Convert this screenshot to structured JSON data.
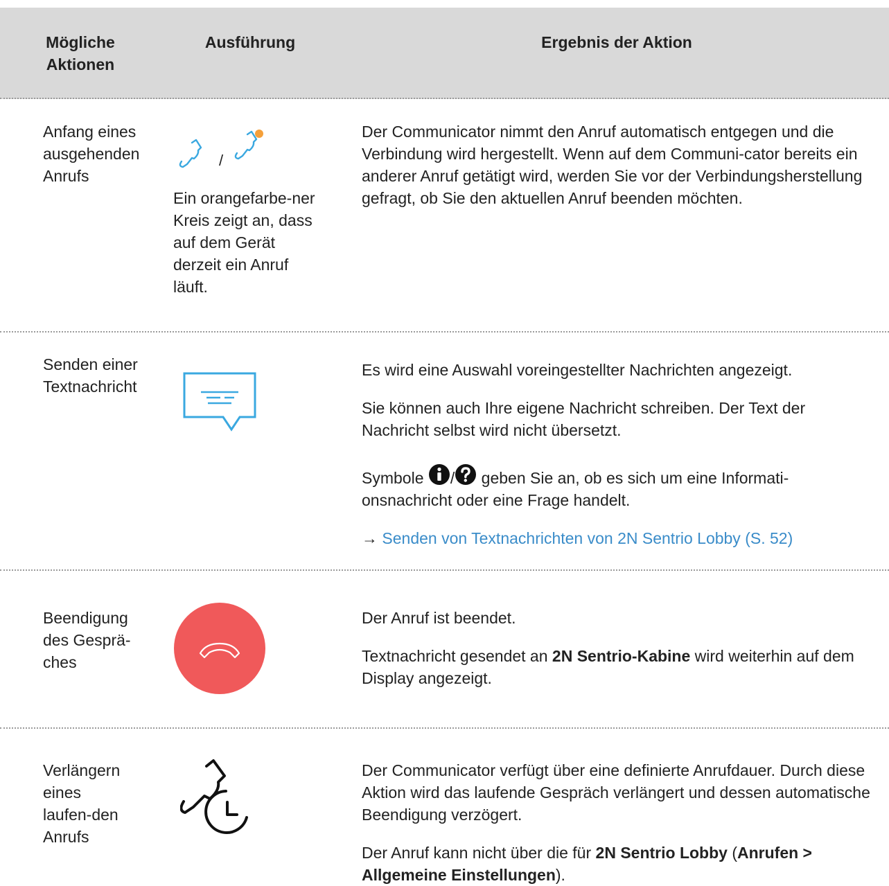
{
  "header": {
    "col1": "Mögliche Aktionen",
    "col2": "Ausführung",
    "col3": "Ergebnis der Aktion"
  },
  "rows": [
    {
      "action": "Anfang eines ausgehenden Anrufs",
      "icons": [
        "phone-handset-icon",
        "phone-handset-active-icon"
      ],
      "icon_separator": "/",
      "execution_note": "Ein orangefarbe-ner Kreis zeigt an, dass auf dem Gerät derzeit ein Anruf läuft.",
      "result": "Der Communicator nimmt den Anruf automatisch entgegen und die Verbindung wird hergestellt. Wenn auf dem Communi-cator bereits ein anderer Anruf getätigt wird, werden Sie vor der Verbindungsherstellung gefragt, ob Sie den aktuellen Anruf beenden möchten."
    },
    {
      "action": "Senden einer Textnachricht",
      "icons": [
        "text-message-icon"
      ],
      "result_p1": "Es wird eine Auswahl voreingestellter Nachrichten angezeigt.",
      "result_p2": "Sie können auch Ihre eigene Nachricht schreiben. Der Text der Nachricht selbst wird nicht übersetzt.",
      "result_p3_prefix": "Symbole ",
      "result_p3_sep": "/",
      "result_p3_suffix": " geben Sie an, ob es sich um eine Informati-onsnachricht oder eine Frage handelt.",
      "info_icon": "info-icon",
      "question_icon": "question-icon",
      "link_arrow": "→ ",
      "link_text": "Senden von Textnachrichten von 2N Sentrio Lobby (S. 52)"
    },
    {
      "action": "Beendigung des Gesprä-ches",
      "icons": [
        "hang-up-icon"
      ],
      "result_p1": "Der Anruf ist beendet.",
      "result_p2_prefix": "Textnachricht gesendet an ",
      "result_p2_bold": "2N Sentrio-Kabine",
      "result_p2_suffix": " wird weiterhin auf dem Display angezeigt."
    },
    {
      "action": "Verlängern eines laufen-den Anrufs",
      "icons": [
        "extend-call-icon"
      ],
      "result_p1": "Der Communicator verfügt über eine definierte Anrufdauer. Durch diese Aktion wird das laufende Gespräch verlängert und dessen automatische Beendigung verzögert.",
      "result_p2_prefix": "Der Anruf kann nicht über die für ",
      "result_p2_bold1": "2N Sentrio Lobby",
      "result_p2_mid": " (",
      "result_p2_bold2": "Anrufen > Allgemeine Einstellungen",
      "result_p2_suffix": ")."
    }
  ],
  "colors": {
    "header_bg": "#d9d9d9",
    "icon_blue": "#3aa8e0",
    "active_dot": "#f5a03a",
    "hangup_red": "#f0595a",
    "link": "#3a8cc9"
  }
}
